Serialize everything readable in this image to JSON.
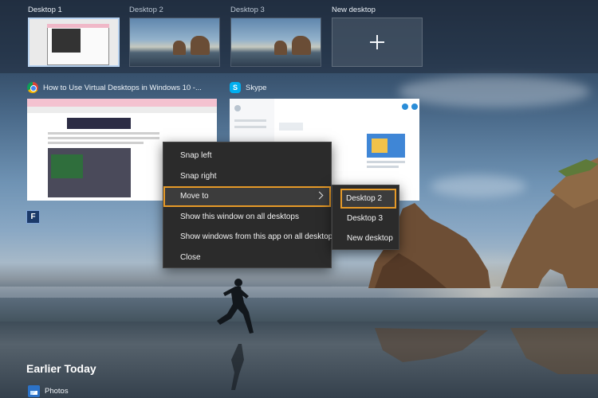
{
  "desktops": [
    {
      "label": "Desktop 1",
      "active": true
    },
    {
      "label": "Desktop 2",
      "active": false
    },
    {
      "label": "Desktop 3",
      "active": false
    }
  ],
  "new_desktop": {
    "label": "New desktop",
    "icon": "plus-icon"
  },
  "windows": [
    {
      "title": "How to Use Virtual Desktops in Windows 10 -...",
      "icon": "chrome-icon"
    },
    {
      "title": "Skype",
      "icon": "skype-icon",
      "icon_glyph": "S"
    }
  ],
  "extra_window_icon": {
    "glyph": "F"
  },
  "context_menu": {
    "items": [
      "Snap left",
      "Snap right",
      "Move to",
      "Show this window on all desktops",
      "Show windows from this app on all desktops",
      "Close"
    ],
    "highlighted": "Move to"
  },
  "submenu": {
    "items": [
      "Desktop 2",
      "Desktop 3",
      "New desktop"
    ],
    "highlighted": "Desktop 2"
  },
  "timeline": {
    "heading": "Earlier Today",
    "items": [
      {
        "label": "Photos",
        "icon": "photos-icon"
      }
    ]
  },
  "colors": {
    "highlight_outline": "#e69a28",
    "menu_bg": "#2b2b2b"
  }
}
